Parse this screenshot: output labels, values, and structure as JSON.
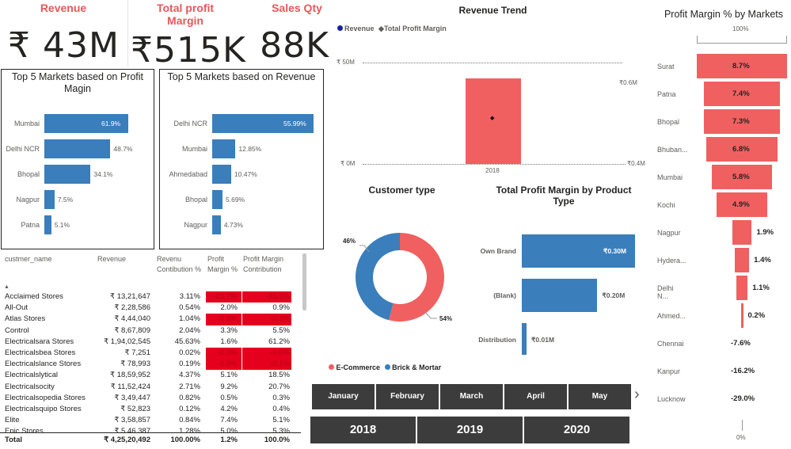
{
  "kpis": {
    "revenue": {
      "title": "Revenue",
      "value": "₹ 43M"
    },
    "profit": {
      "title": "Total profit Margin",
      "value": "₹515K"
    },
    "sales": {
      "title": "Sales Qty",
      "value": "88K"
    }
  },
  "top_markets_margin": {
    "title": "Top 5 Markets based on Profit Magin",
    "markets": [
      "Mumbai",
      "Delhi NCR",
      "Bhopal",
      "Nagpur",
      "Patna"
    ],
    "values": [
      61.9,
      48.7,
      34.1,
      7.5,
      5.1
    ],
    "labels": [
      "61.9%",
      "48.7%",
      "34.1%",
      "7.5%",
      "5.1%"
    ]
  },
  "top_markets_revenue": {
    "title": "Top 5 Markets based on Revenue",
    "markets": [
      "Delhi NCR",
      "Mumbai",
      "Ahmedabad",
      "Bhopal",
      "Nagpur"
    ],
    "values": [
      55.99,
      12.85,
      10.47,
      5.69,
      4.73
    ],
    "labels": [
      "55.99%",
      "12.85%",
      "10.47%",
      "5.69%",
      "4.73%"
    ]
  },
  "table": {
    "headers": {
      "name": "custmer_name",
      "revenue": "Revenue",
      "rev_contrib": "Revenu Contibution %",
      "profit_margin": "Profit Margin %",
      "pm_contrib": "Profit Margin Contribution"
    },
    "sort_indicator": "▲",
    "rows": [
      {
        "name": "Acclaimed Stores",
        "revenue": "₹ 13,21,647",
        "rev_contrib": "3.11%",
        "pm": "-13.7%",
        "pm_contrib": "-35.3%",
        "neg": true
      },
      {
        "name": "All-Out",
        "revenue": "₹ 2,28,586",
        "rev_contrib": "0.54%",
        "pm": "2.0%",
        "pm_contrib": "0.9%",
        "neg": false
      },
      {
        "name": "Atlas Stores",
        "revenue": "₹ 4,44,040",
        "rev_contrib": "1.04%",
        "pm": "-0.3%",
        "pm_contrib": "-0.3%",
        "neg": true
      },
      {
        "name": "Control",
        "revenue": "₹ 8,67,809",
        "rev_contrib": "2.04%",
        "pm": "3.3%",
        "pm_contrib": "5.5%",
        "neg": false
      },
      {
        "name": "Electricalsara Stores",
        "revenue": "₹ 1,94,02,545",
        "rev_contrib": "45.63%",
        "pm": "1.6%",
        "pm_contrib": "61.2%",
        "neg": false
      },
      {
        "name": "Electricalsbea Stores",
        "revenue": "₹ 7,251",
        "rev_contrib": "0.02%",
        "pm": "-2.3%",
        "pm_contrib": "-0.0%",
        "neg": true
      },
      {
        "name": "Electricalslance Stores",
        "revenue": "₹ 78,993",
        "rev_contrib": "0.19%",
        "pm": "-0.8%",
        "pm_contrib": "-0.1%",
        "neg": true
      },
      {
        "name": "Electricalslytical",
        "revenue": "₹ 18,59,952",
        "rev_contrib": "4.37%",
        "pm": "5.1%",
        "pm_contrib": "18.5%",
        "neg": false
      },
      {
        "name": "Electricalsocity",
        "revenue": "₹ 11,52,424",
        "rev_contrib": "2.71%",
        "pm": "9.2%",
        "pm_contrib": "20.7%",
        "neg": false
      },
      {
        "name": "Electricalsopedia Stores",
        "revenue": "₹ 3,49,447",
        "rev_contrib": "0.82%",
        "pm": "0.5%",
        "pm_contrib": "0.3%",
        "neg": false
      },
      {
        "name": "Electricalsquipo Stores",
        "revenue": "₹ 52,823",
        "rev_contrib": "0.12%",
        "pm": "4.2%",
        "pm_contrib": "0.4%",
        "neg": false
      },
      {
        "name": "Elite",
        "revenue": "₹ 3,58,857",
        "rev_contrib": "0.84%",
        "pm": "7.4%",
        "pm_contrib": "5.1%",
        "neg": false
      },
      {
        "name": "Epic Stores",
        "revenue": "₹ 5,46,387",
        "rev_contrib": "1.28%",
        "pm": "5.0%",
        "pm_contrib": "5.3%",
        "neg": false
      }
    ],
    "total": {
      "name": "Total",
      "revenue": "₹ 4,25,20,492",
      "rev_contrib": "100.00%",
      "pm": "1.2%",
      "pm_contrib": "100.0%"
    }
  },
  "revenue_trend": {
    "title": "Revenue Trend",
    "legend": [
      "Revenue",
      "Total Profit Margin"
    ],
    "y_left": [
      "₹ 50M",
      "₹ 0M"
    ],
    "y_right": [
      "₹0.6M",
      "₹0.4M"
    ],
    "x_label": "2018",
    "colors": {
      "revenue": "#f06060",
      "marker": "#12239e"
    }
  },
  "customer_type": {
    "title": "Customer type",
    "slices": [
      {
        "name": "E-Commerce",
        "value": 54,
        "label": "54%",
        "color": "#f06060"
      },
      {
        "name": "Brick & Mortar",
        "value": 46,
        "label": "46%",
        "color": "#3a7ebc"
      }
    ]
  },
  "product_type": {
    "title": "Total Profit Margin by Product Type",
    "categories": [
      "Own Brand",
      "(Blank)",
      "Distribution"
    ],
    "values": [
      0.3,
      0.2,
      0.01
    ],
    "labels": [
      "₹0.30M",
      "₹0.20M",
      "₹0.01M"
    ]
  },
  "months": [
    "January",
    "February",
    "March",
    "April",
    "May"
  ],
  "years": [
    "2018",
    "2019",
    "2020"
  ],
  "next_arrow": "›",
  "margin_funnel": {
    "title": "Profit Margin % by Markets",
    "top_label": "100%",
    "bottom_label": "0%",
    "markets": [
      "Surat",
      "Patna",
      "Bhopal",
      "Bhuban...",
      "Mumbai",
      "Kochi",
      "Nagpur",
      "Hydera...",
      "Delhi N...",
      "Ahmed...",
      "Chennai",
      "Kanpur",
      "Lucknow"
    ],
    "values": [
      8.7,
      7.4,
      7.3,
      6.8,
      5.8,
      4.9,
      1.9,
      1.4,
      1.1,
      0.2,
      -7.6,
      -16.2,
      -29.0
    ],
    "labels": [
      "8.7%",
      "7.4%",
      "7.3%",
      "6.8%",
      "5.8%",
      "4.9%",
      "1.9%",
      "1.4%",
      "1.1%",
      "0.2%",
      "-7.6%",
      "-16.2%",
      "-29.0%"
    ]
  }
}
